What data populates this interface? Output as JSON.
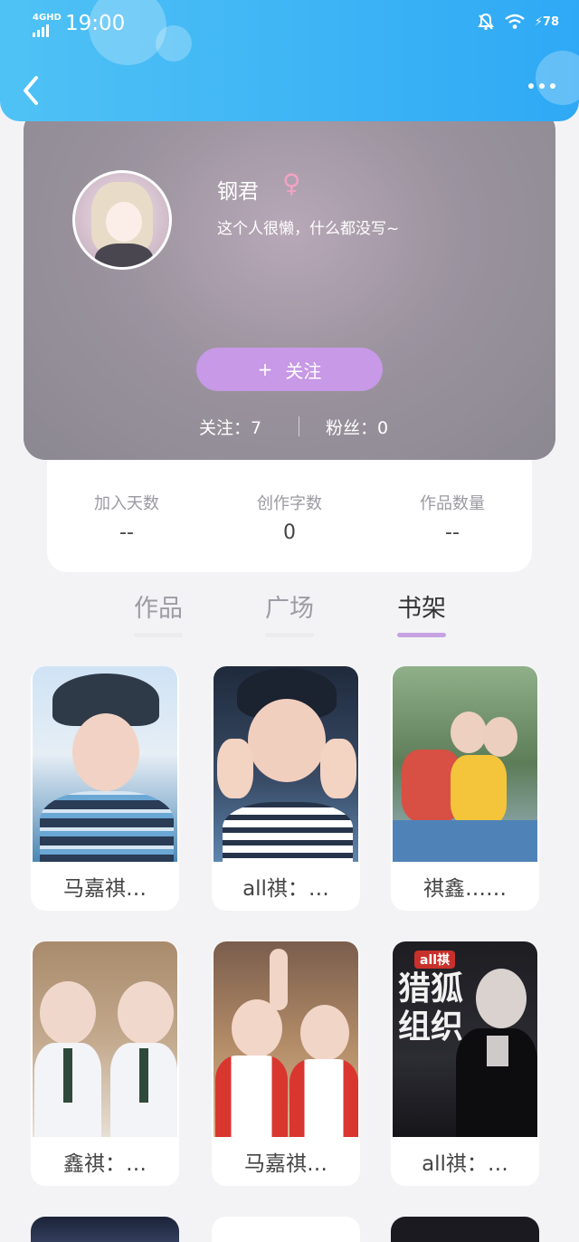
{
  "status_bar": {
    "network": "4GHD",
    "time": "19:00",
    "battery": "78"
  },
  "profile": {
    "nickname": "钢君",
    "gender_symbol": "♀",
    "signature": "这个人很懒，什么都没写~",
    "follow_button": {
      "plus": "+",
      "label": "关注"
    },
    "following": "关注：7",
    "fans": "粉丝：0"
  },
  "stats": [
    {
      "label": "加入天数",
      "value": "--"
    },
    {
      "label": "创作字数",
      "value": "0"
    },
    {
      "label": "作品数量",
      "value": "--"
    }
  ],
  "tabs": [
    {
      "label": "作品",
      "active": false
    },
    {
      "label": "广场",
      "active": false
    },
    {
      "label": "书架",
      "active": true
    }
  ],
  "books": [
    {
      "title": "马嘉祺…"
    },
    {
      "title": "all祺：…"
    },
    {
      "title": "祺鑫……"
    },
    {
      "title": "鑫祺：…"
    },
    {
      "title": "马嘉祺…"
    },
    {
      "title": "all祺：…"
    }
  ],
  "cover_text": {
    "badge": "all祺",
    "main": "猎狐组织"
  },
  "colors": {
    "header": "#2fa9f5",
    "accent": "#c799e6",
    "gender": "#f2a3c2"
  }
}
